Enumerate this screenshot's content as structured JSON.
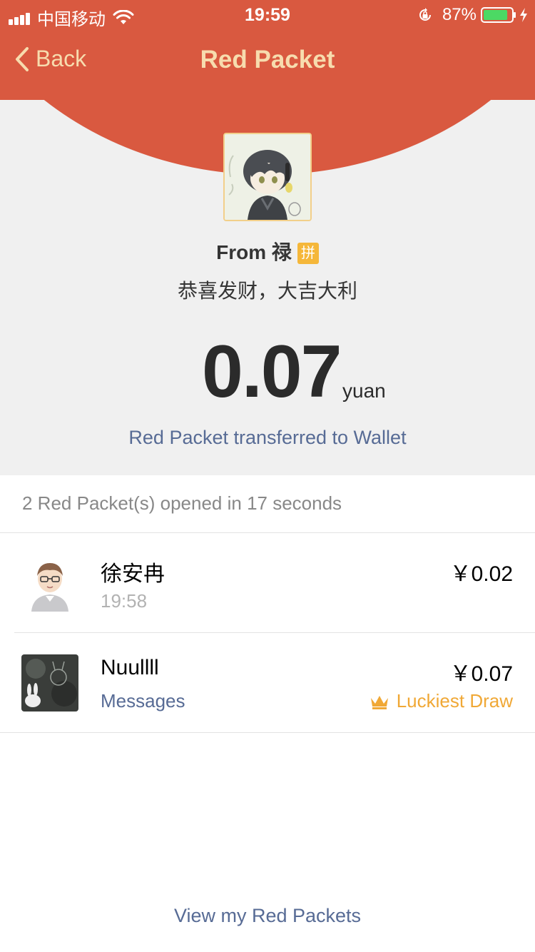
{
  "status_bar": {
    "carrier": "中国移动",
    "time": "19:59",
    "battery": "87%",
    "battery_level": 0.87
  },
  "nav": {
    "back_label": "Back",
    "title": "Red Packet"
  },
  "packet": {
    "from": "From 禄",
    "badge": "拼",
    "wish": "恭喜发财，大吉大利",
    "amount": "0.07",
    "unit": "yuan",
    "wallet_link": "Red Packet transferred to Wallet"
  },
  "summary": "2 Red Packet(s) opened in 17 seconds",
  "recipients": [
    {
      "name": "徐安冉",
      "sub": "19:58",
      "amount": "￥0.02"
    },
    {
      "name": "Nuullll",
      "sub": "Messages",
      "amount": "￥0.07",
      "tag": "Luckiest Draw"
    }
  ],
  "footer_link": "View my Red Packets",
  "colors": {
    "header_red": "#d95940",
    "title_gold": "#f7dcae",
    "link_blue": "#576b95",
    "lucky_orange": "#f0a836"
  }
}
